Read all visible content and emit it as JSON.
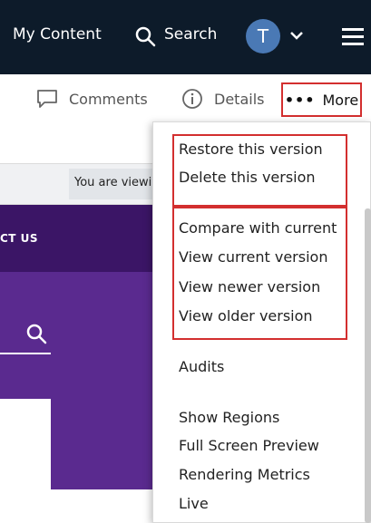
{
  "topnav": {
    "my_content": "My Content",
    "search_label": "Search",
    "avatar_initial": "T"
  },
  "toolbar": {
    "comments_label": "Comments",
    "details_label": "Details",
    "more_label": "More"
  },
  "content": {
    "banner_text": "You are viewing",
    "contact_label": "CT US"
  },
  "menu": {
    "items": [
      "Restore this version",
      "Delete this version",
      "Compare with current",
      "View current version",
      "View newer version",
      "View older version",
      "Audits",
      "Show Regions",
      "Full Screen Preview",
      "Rendering Metrics",
      "Live"
    ]
  },
  "colors": {
    "nav_bg": "#0d1b2a",
    "avatar_bg": "#4a79b5",
    "highlight_red": "#d32f2f",
    "purple_dark": "#3b1566",
    "purple_main": "#5a2a8f"
  }
}
